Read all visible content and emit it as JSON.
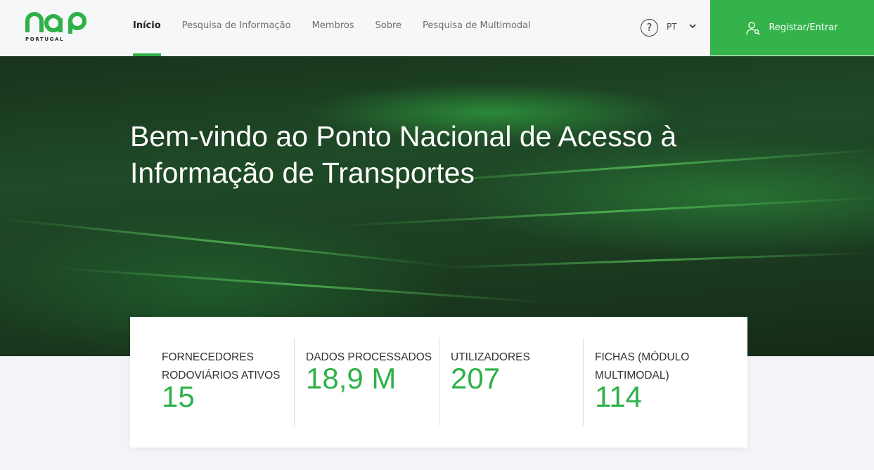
{
  "logo": {
    "name": "nap",
    "subtitle": "PORTUGAL"
  },
  "nav": [
    {
      "label": "Início",
      "active": true
    },
    {
      "label": "Pesquisa de Informação",
      "active": false
    },
    {
      "label": "Membros",
      "active": false
    },
    {
      "label": "Sobre",
      "active": false
    },
    {
      "label": "Pesquisa de Multimodal",
      "active": false
    }
  ],
  "header": {
    "help_symbol": "?",
    "language": "PT",
    "login_label": "Registar/Entrar"
  },
  "hero": {
    "title": "Bem-vindo ao Ponto Nacional de Acesso à Informação de Transportes"
  },
  "stats": [
    {
      "label": "Fornecedores rodoviários ativos",
      "value": "15"
    },
    {
      "label": "Dados processados",
      "value": "18,9 M"
    },
    {
      "label": "Utilizadores",
      "value": "207"
    },
    {
      "label": "Fichas (módulo multimodal)",
      "value": "114"
    }
  ],
  "colors": {
    "accent": "#33b34a",
    "hero_dark": "#1c3f22"
  },
  "icons": {
    "help": "question-circle-icon",
    "chevron": "chevron-down-icon",
    "login": "user-key-icon"
  }
}
